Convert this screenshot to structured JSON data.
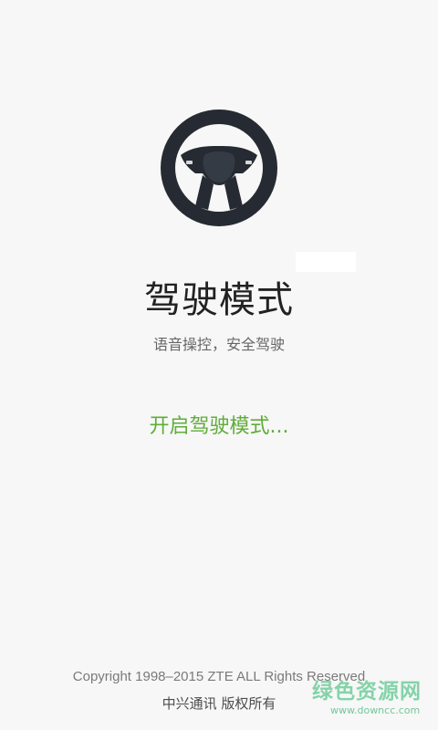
{
  "app": {
    "title": "驾驶模式",
    "subtitle": "语音操控，安全驾驶",
    "status": "开启驾驶模式..."
  },
  "footer": {
    "copyright": "Copyright 1998–2015 ZTE ALL Rights Reserved",
    "company": "中兴通讯 版权所有"
  },
  "watermark": {
    "cn": "绿色资源网",
    "url": "www.downcc.com"
  },
  "icons": {
    "hero": "steering-wheel-icon"
  },
  "colors": {
    "background": "#f7f7f7",
    "title": "#222222",
    "subtitle": "#666666",
    "status": "#5fad3a",
    "icon": "#262a32",
    "watermark": "#7ed2a5"
  }
}
